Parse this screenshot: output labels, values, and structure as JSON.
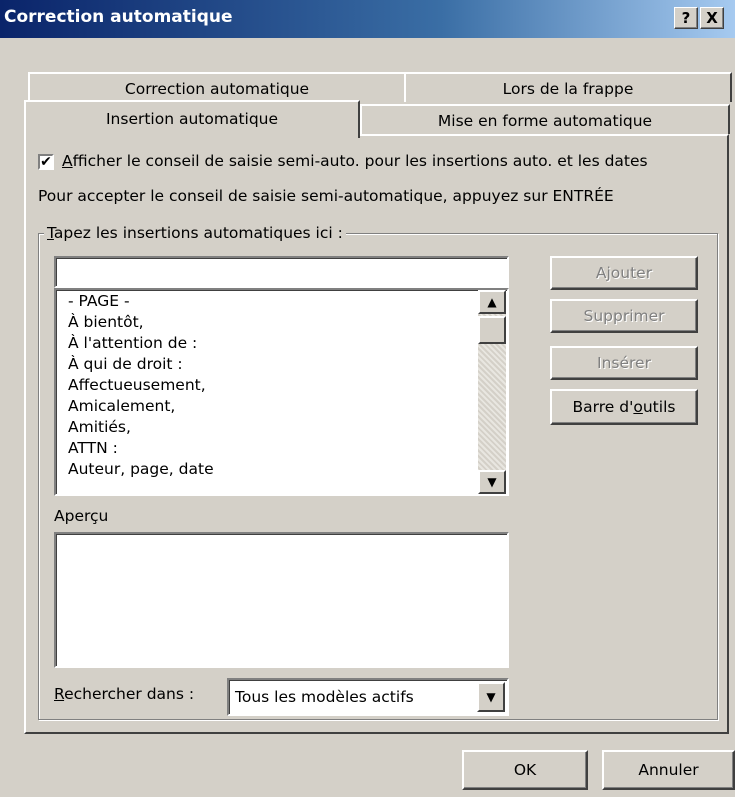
{
  "window": {
    "title": "Correction automatique",
    "help_label": "?",
    "close_label": "X"
  },
  "tabs": [
    {
      "label": "Correction automatique"
    },
    {
      "label": "Lors de la frappe"
    },
    {
      "label": "Insertion automatique"
    },
    {
      "label": "Mise en forme automatique"
    }
  ],
  "checkbox": {
    "checked_mark": "✔",
    "label_first": "A",
    "label_rest": "fficher le conseil de saisie semi-auto. pour les insertions auto. et les dates"
  },
  "hint": "Pour accepter le conseil de saisie semi-automatique, appuyez sur ENTRÉE",
  "group": {
    "legend_first": "T",
    "legend_rest": "apez les insertions automatiques ici :"
  },
  "entry_input": {
    "value": ""
  },
  "list_items": [
    "- PAGE -",
    "À bientôt,",
    "À l'attention de :",
    "À qui de droit :",
    "Affectueusement,",
    "Amicalement,",
    "Amitiés,",
    "ATTN :",
    "Auteur, page, date"
  ],
  "scrollbar": {
    "up_icon": "▲",
    "down_icon": "▼"
  },
  "buttons": {
    "add": "Ajouter",
    "delete": "Supprimer",
    "insert": "Insérer",
    "toolbar_pre": "Barre d'",
    "toolbar_ul": "o",
    "toolbar_post": "utils"
  },
  "preview_label": "Aperçu",
  "search": {
    "label_first": "R",
    "label_rest": "echercher dans :",
    "selected": "Tous les modèles actifs",
    "dropdown_icon": "▼"
  },
  "footer": {
    "ok": "OK",
    "cancel": "Annuler"
  }
}
